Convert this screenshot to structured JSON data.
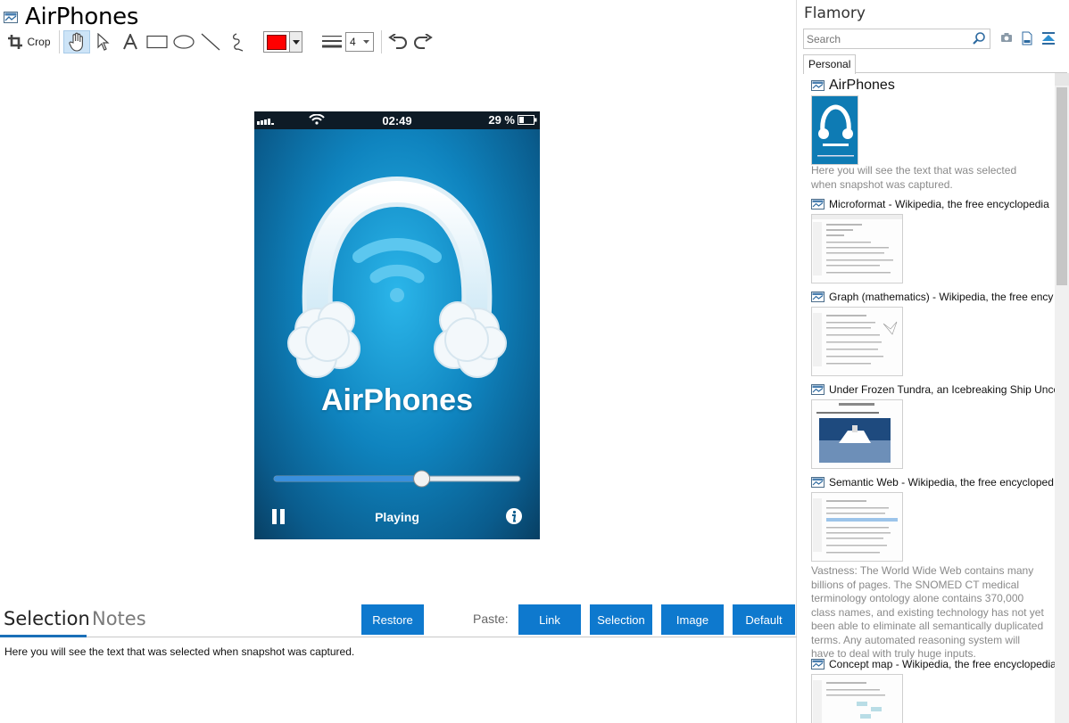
{
  "window": {
    "title": "AirPhones"
  },
  "toolbar": {
    "crop_label": "Crop",
    "stroke_width": "4",
    "color": "#ff0000"
  },
  "phone": {
    "time": "02:49",
    "battery": "29 %",
    "app_name": "AirPhones",
    "playing": "Playing",
    "progress": 0.6
  },
  "tabs": {
    "selection": "Selection",
    "notes": "Notes"
  },
  "buttons": {
    "restore": "Restore",
    "paste_label": "Paste:",
    "link": "Link",
    "selection": "Selection",
    "image": "Image",
    "default": "Default"
  },
  "selection_text": "Here you will see the text that was selected when snapshot was captured.",
  "sidebar": {
    "app_title": "Flamory",
    "search_placeholder": "Search",
    "tab": "Personal",
    "items": [
      {
        "title": "AirPhones",
        "note": "Here you will see the text that was selected when snapshot was captured."
      },
      {
        "title": "Microformat - Wikipedia, the free encyclopedia"
      },
      {
        "title": "Graph (mathematics) - Wikipedia, the free ency"
      },
      {
        "title": "Under Frozen Tundra, an Icebreaking Ship Unco"
      },
      {
        "title": "Semantic Web - Wikipedia, the free encycloped",
        "note": "Vastness: The World Wide Web contains many billions of pages. The SNOMED CT medical terminology ontology alone contains 370,000 class names, and existing technology has not yet been able to eliminate all semantically duplicated terms. Any automated reasoning system will have to deal with truly huge inputs."
      },
      {
        "title": "Concept map - Wikipedia, the free encyclopedia"
      }
    ]
  },
  "colors": {
    "accent": "#0e79ce",
    "tab_underline": "#1a6fb8"
  }
}
